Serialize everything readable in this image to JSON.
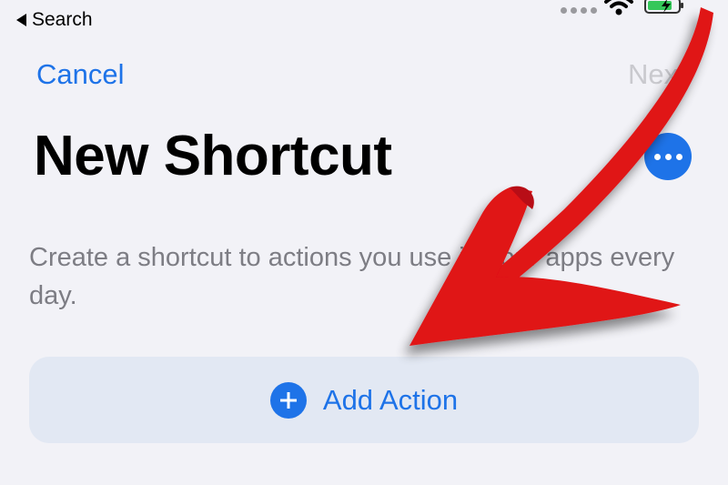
{
  "status_bar": {
    "back_label": "Search",
    "back_icon": "back-triangle-icon",
    "signal_icon": "cellular-signal-icon",
    "wifi_icon": "wifi-icon",
    "battery_icon": "battery-charging-icon"
  },
  "nav": {
    "cancel_label": "Cancel",
    "next_label": "Next"
  },
  "header": {
    "title": "New Shortcut",
    "more_icon": "ellipsis-icon"
  },
  "main": {
    "description": "Create a shortcut to actions you use in your apps every day.",
    "add_action_label": "Add Action",
    "add_icon": "plus-circle-icon"
  },
  "overlay": {
    "annotation": "red-arrow",
    "arrow_color": "#e01218"
  },
  "colors": {
    "accent": "#1e73e8",
    "background": "#f2f2f7",
    "disabled": "#c9c9ce",
    "secondary_text": "#7d7d84"
  }
}
